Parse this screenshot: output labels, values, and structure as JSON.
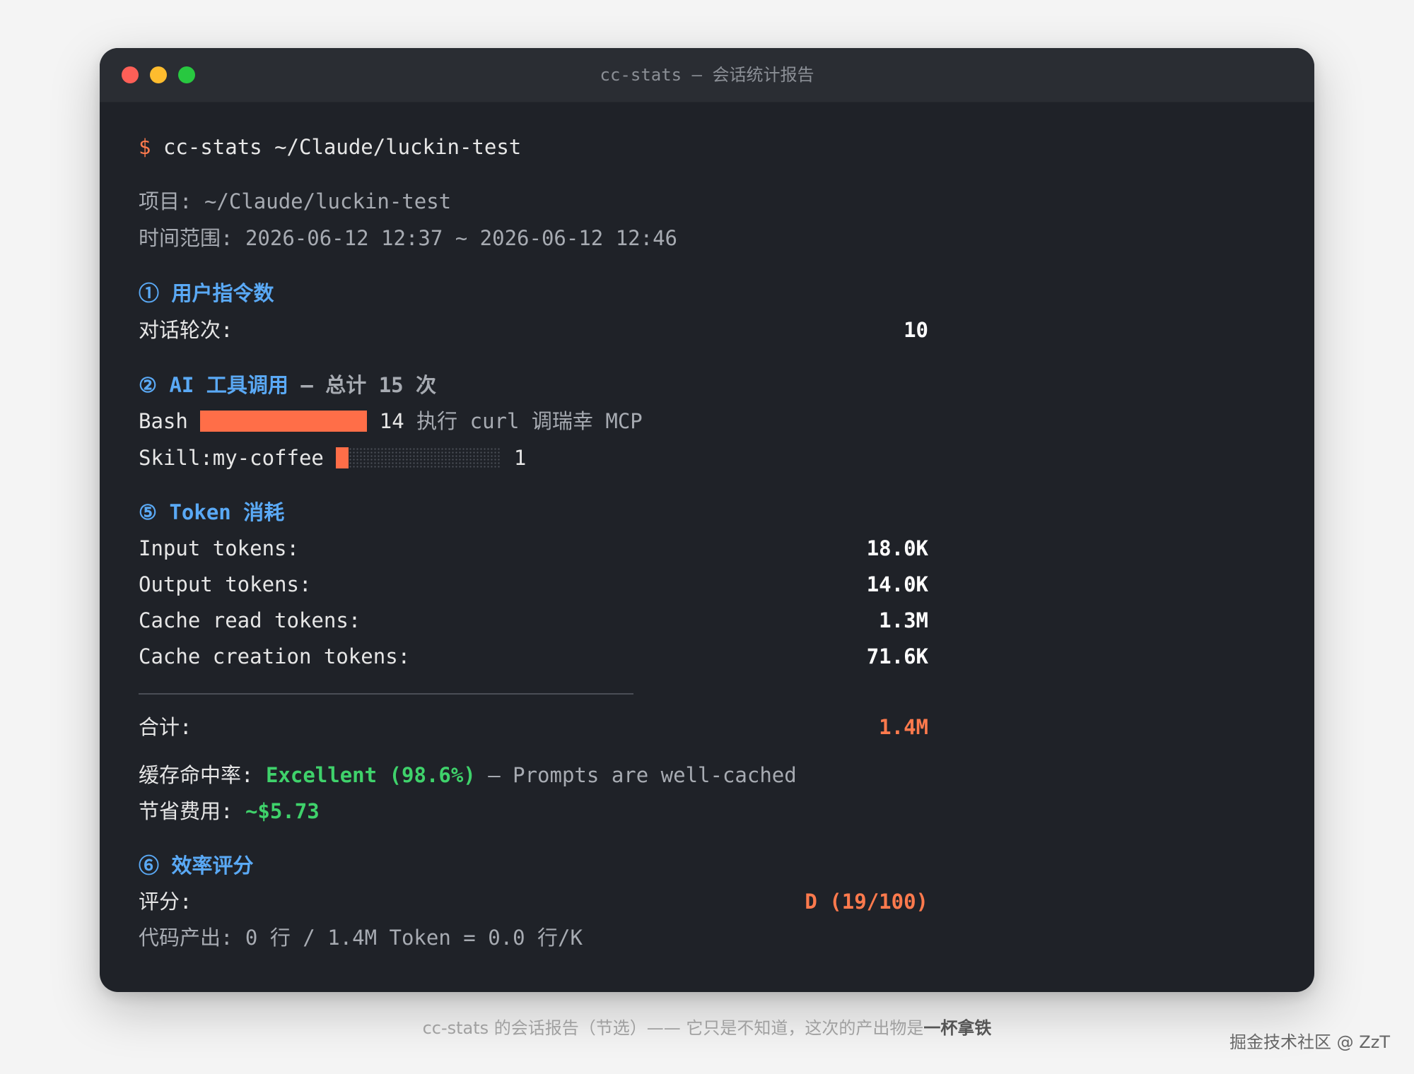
{
  "window": {
    "title": "cc-stats — 会话统计报告"
  },
  "command": {
    "prompt": "$",
    "text": "cc-stats ~/Claude/luckin-test"
  },
  "meta": {
    "project_label": "项目:",
    "project_value": "~/Claude/luckin-test",
    "time_label": "时间范围:",
    "time_value": "2026-06-12 12:37 ~ 2026-06-12 12:46"
  },
  "section1": {
    "title": "① 用户指令数",
    "rounds_label": "对话轮次:",
    "rounds_value": "10"
  },
  "section2": {
    "title": "② AI 工具调用",
    "subtitle": "— 总计 15 次",
    "tools": [
      {
        "name": "Bash",
        "count": "14",
        "note": "执行 curl 调瑞幸 MCP",
        "fill_fraction": 1.0
      },
      {
        "name": "Skill:my-coffee",
        "count": "1",
        "note": "",
        "fill_fraction": 0.07
      }
    ]
  },
  "section5": {
    "title": "⑤ Token 消耗",
    "rows": [
      {
        "label": "Input tokens:",
        "value": "18.0K"
      },
      {
        "label": "Output tokens:",
        "value": "14.0K"
      },
      {
        "label": "Cache read tokens:",
        "value": "1.3M"
      },
      {
        "label": "Cache creation tokens:",
        "value": "71.6K"
      }
    ],
    "total_label": "合计:",
    "total_value": "1.4M",
    "cache_label": "缓存命中率:",
    "cache_value": "Excellent (98.6%)",
    "cache_note": "— Prompts are well-cached",
    "saving_label": "节省费用:",
    "saving_value": "~$5.73"
  },
  "section6": {
    "title": "⑥ 效率评分",
    "score_label": "评分:",
    "score_value": "D (19/100)",
    "output_line": "代码产出: 0 行 / 1.4M Token = 0.0 行/K"
  },
  "caption": {
    "text": "cc-stats 的会话报告（节选）—— 它只是不知道，这次的产出物是",
    "emphasis": "一杯拿铁"
  },
  "watermark": "掘金技术社区 @ ZzT",
  "colors": {
    "accent": "#ff7a4d",
    "section": "#5aa9f5",
    "success": "#3fd26b",
    "bg": "#1f2228"
  }
}
